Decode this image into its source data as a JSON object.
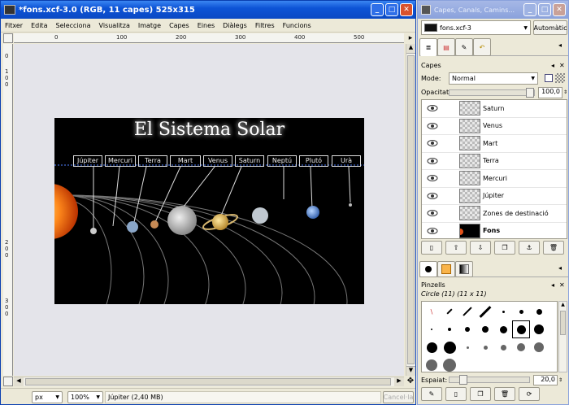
{
  "image_window": {
    "title": "*fons.xcf-3.0 (RGB, 11 capes) 525x315",
    "menu": [
      "Fitxer",
      "Edita",
      "Selecciona",
      "Visualitza",
      "Imatge",
      "Capes",
      "Eines",
      "Diàlegs",
      "Filtres",
      "Funcions"
    ],
    "ruler_top": [
      "0",
      "100",
      "200",
      "300",
      "400",
      "500"
    ],
    "ruler_left": [
      "0",
      "1 0 0",
      "2 0 0",
      "3 0 0"
    ],
    "canvas": {
      "title": "El Sistema Solar",
      "planet_labels": [
        "Júpiter",
        "Mercuri",
        "Terra",
        "Mart",
        "Venus",
        "Saturn",
        "Neptú",
        "Plutó",
        "Urà"
      ]
    },
    "status": {
      "unit": "px",
      "zoom": "100%",
      "layer_info": "Júpiter (2,40 MB)",
      "cancel": "Cancel·la"
    }
  },
  "dock_window": {
    "title": "Capes, Canals, Camins...",
    "image_select": "fons.xcf-3",
    "auto_button": "Automàtic",
    "layers": {
      "tab_title": "Capes",
      "mode_label": "Mode:",
      "mode_value": "Normal",
      "opacity_label": "Opacitat:",
      "opacity_value": "100,0",
      "items": [
        "Saturn",
        "Venus",
        "Mart",
        "Terra",
        "Mercuri",
        "Júpiter",
        "Zones de destinació",
        "Fons"
      ]
    },
    "brushes": {
      "tab_title": "Pinzells",
      "brush_name": "Circle (11) (11 x 11)",
      "spacing_label": "Espaiat:",
      "spacing_value": "20,0"
    }
  }
}
